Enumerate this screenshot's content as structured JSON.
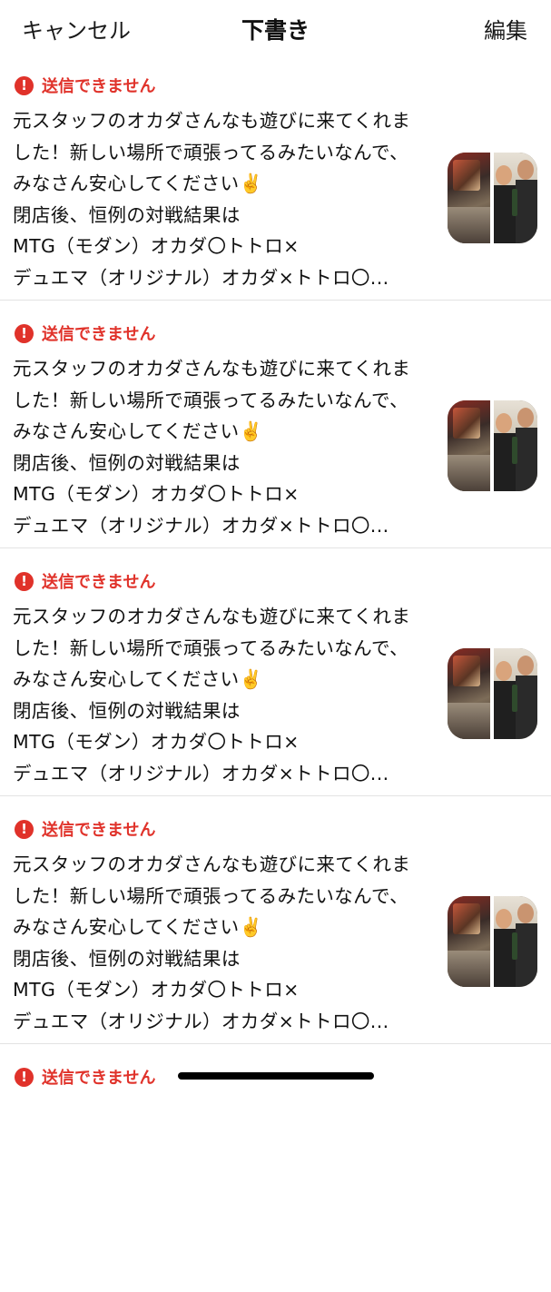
{
  "nav": {
    "cancel_label": "キャンセル",
    "title": "下書き",
    "edit_label": "編集"
  },
  "drafts": [
    {
      "status": "送信できません",
      "lines": [
        "元スタッフのオカダさんなも遊びに来てくれま",
        "した！新しい場所で頑張ってるみたいなんで、",
        "みなさん安心してください✌️",
        "閉店後、恒例の対戦結果は",
        "MTG（モダン）オカダ〇トトロ×",
        "デュエマ（オリジナル）オカダ×トトロ〇..."
      ]
    },
    {
      "status": "送信できません",
      "lines": [
        "元スタッフのオカダさんなも遊びに来てくれま",
        "した！新しい場所で頑張ってるみたいなんで、",
        "みなさん安心してください✌️",
        "閉店後、恒例の対戦結果は",
        "MTG（モダン）オカダ〇トトロ×",
        "デュエマ（オリジナル）オカダ×トトロ〇..."
      ]
    },
    {
      "status": "送信できません",
      "lines": [
        "元スタッフのオカダさんなも遊びに来てくれま",
        "した！新しい場所で頑張ってるみたいなんで、",
        "みなさん安心してください✌️",
        "閉店後、恒例の対戦結果は",
        "MTG（モダン）オカダ〇トトロ×",
        "デュエマ（オリジナル）オカダ×トトロ〇..."
      ]
    },
    {
      "status": "送信できません",
      "lines": [
        "元スタッフのオカダさんなも遊びに来てくれま",
        "した！新しい場所で頑張ってるみたいなんで、",
        "みなさん安心してください✌️",
        "閉店後、恒例の対戦結果は",
        "MTG（モダン）オカダ〇トトロ×",
        "デュエマ（オリジナル）オカダ×トトロ〇..."
      ]
    },
    {
      "status": "送信できません",
      "lines": []
    }
  ],
  "icons": {
    "error": "!"
  },
  "colors": {
    "error": "#e0322a"
  }
}
